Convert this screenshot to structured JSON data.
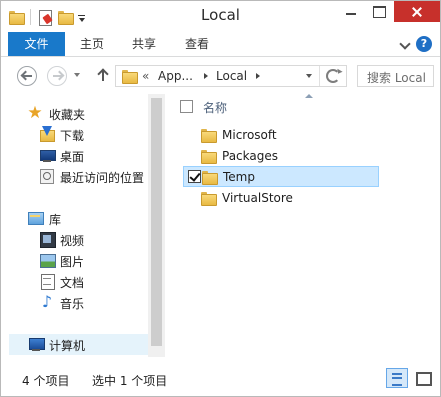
{
  "window": {
    "title": "Local"
  },
  "quick_access": {
    "icons": [
      "folder-icon",
      "properties-icon",
      "new-folder-icon",
      "customize-arrow-icon"
    ]
  },
  "ribbon": {
    "tabs": [
      {
        "label": "文件",
        "active": true
      },
      {
        "label": "主页"
      },
      {
        "label": "共享"
      },
      {
        "label": "查看"
      }
    ],
    "accent": "#1979ca"
  },
  "address": {
    "overflow": "«",
    "segments": [
      "App...",
      "Local"
    ],
    "search_placeholder": "搜索 Local"
  },
  "nav_pane": {
    "favorites_label": "收藏夹",
    "favorites": [
      {
        "label": "下载",
        "icon": "download-icon"
      },
      {
        "label": "桌面",
        "icon": "desktop-icon"
      },
      {
        "label": "最近访问的位置",
        "icon": "recent-places-icon"
      }
    ],
    "libraries_label": "库",
    "libraries": [
      {
        "label": "视频",
        "icon": "video-icon"
      },
      {
        "label": "图片",
        "icon": "pictures-icon"
      },
      {
        "label": "文档",
        "icon": "documents-icon"
      },
      {
        "label": "音乐",
        "icon": "music-icon"
      }
    ],
    "computer_label": "计算机"
  },
  "file_list": {
    "column_name": "名称",
    "items": [
      {
        "name": "Microsoft",
        "selected": false
      },
      {
        "name": "Packages",
        "selected": false
      },
      {
        "name": "Temp",
        "selected": true
      },
      {
        "name": "VirtualStore",
        "selected": false
      }
    ],
    "selection_color": "#cce8ff"
  },
  "status": {
    "item_count": "4 个项目",
    "selected": "选中 1 个项目"
  }
}
